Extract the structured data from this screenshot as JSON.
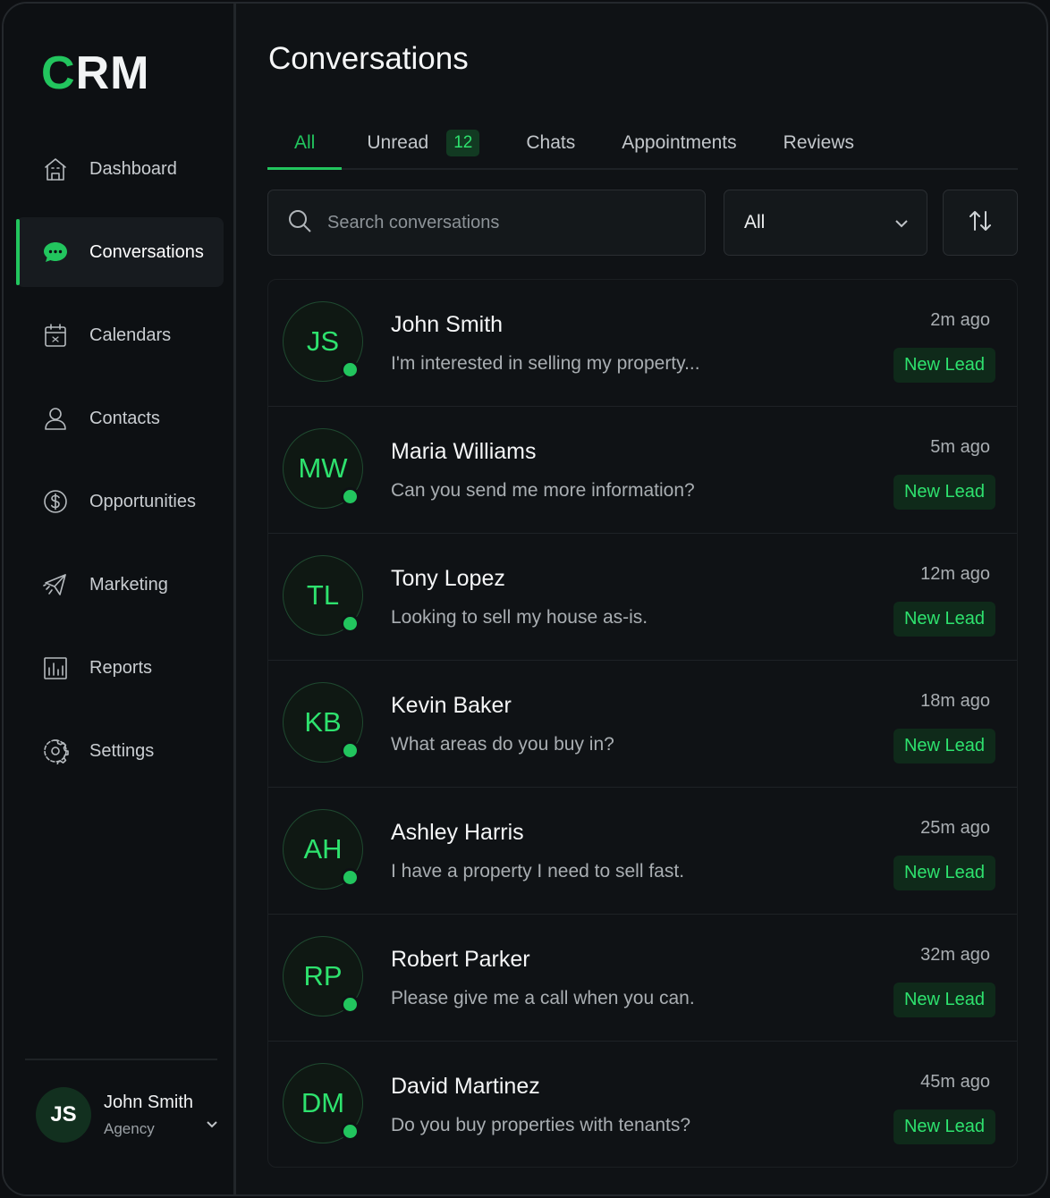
{
  "app": {
    "logo_first": "C",
    "logo_rest": "RM"
  },
  "sidebar": {
    "items": [
      {
        "label": "Dashboard",
        "icon": "building-icon"
      },
      {
        "label": "Conversations",
        "icon": "chat-icon"
      },
      {
        "label": "Calendars",
        "icon": "calendar-icon"
      },
      {
        "label": "Contacts",
        "icon": "user-icon"
      },
      {
        "label": "Opportunities",
        "icon": "dollar-icon"
      },
      {
        "label": "Marketing",
        "icon": "megaphone-icon"
      },
      {
        "label": "Reports",
        "icon": "bar-chart-icon"
      },
      {
        "label": "Settings",
        "icon": "gear-icon"
      }
    ],
    "active": "Conversations",
    "profile": {
      "initials": "JS",
      "name": "John Smith",
      "role": "Agency"
    }
  },
  "main": {
    "title": "Conversations",
    "tabs": [
      {
        "label": "All"
      },
      {
        "label": "Unread",
        "badge": "12"
      },
      {
        "label": "Chats"
      },
      {
        "label": "Appointments"
      },
      {
        "label": "Reviews"
      }
    ],
    "active_tab": "All",
    "search": {
      "placeholder": "Search conversations"
    },
    "filter": {
      "value": "All"
    },
    "conversations": [
      {
        "initials": "JS",
        "name": "John Smith",
        "preview": "I'm interested in selling my property...",
        "time": "2m ago",
        "tag": "New Lead"
      },
      {
        "initials": "MW",
        "name": "Maria Williams",
        "preview": "Can you send me more information?",
        "time": "5m ago",
        "tag": "New Lead"
      },
      {
        "initials": "TL",
        "name": "Tony Lopez",
        "preview": "Looking to sell my house as-is.",
        "time": "12m ago",
        "tag": "New Lead"
      },
      {
        "initials": "KB",
        "name": "Kevin Baker",
        "preview": "What areas do you buy in?",
        "time": "18m ago",
        "tag": "New Lead"
      },
      {
        "initials": "AH",
        "name": "Ashley Harris",
        "preview": "I have a property I need to sell fast.",
        "time": "25m ago",
        "tag": "New Lead"
      },
      {
        "initials": "RP",
        "name": "Robert Parker",
        "preview": "Please give me a call when you can.",
        "time": "32m ago",
        "tag": "New Lead"
      },
      {
        "initials": "DM",
        "name": "David Martinez",
        "preview": "Do you buy properties with tenants?",
        "time": "45m ago",
        "tag": "New Lead"
      }
    ]
  },
  "colors": {
    "accent": "#22c55e",
    "background": "#0f1215"
  }
}
